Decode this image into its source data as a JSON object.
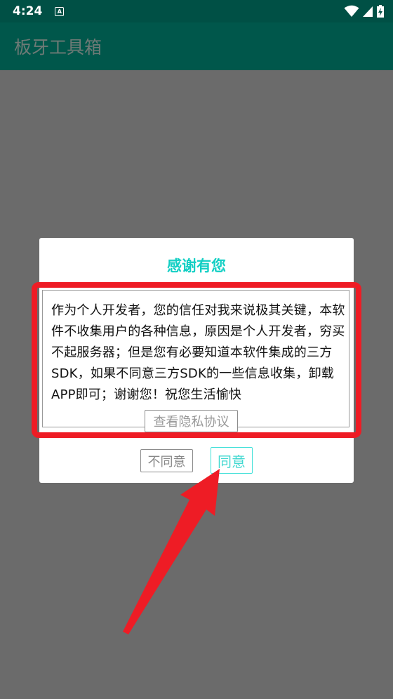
{
  "status_bar": {
    "time": "4:24",
    "notification_icon_letter": "A",
    "icons": [
      "wifi-icon",
      "signal-icon",
      "battery-charging-icon"
    ]
  },
  "app_bar": {
    "title": "板牙工具箱"
  },
  "dialog": {
    "title": "感谢有您",
    "body": "作为个人开发者，您的信任对我来说极其关键，本软件不收集用户的各种信息，原因是个人开发者，穷买不起服务器；但是您有必要知道本软件集成的三方SDK，如果不同意三方SDK的一些信息收集，卸载APP即可；谢谢您！祝您生活愉快",
    "privacy_button_label": "查看隐私协议",
    "disagree_button_label": "不同意",
    "agree_button_label": "同意"
  },
  "colors": {
    "status_bar": "#005045",
    "app_bar": "#00574b",
    "accent": "#12cfc4",
    "annotation": "#ee1c25",
    "scrim": "#6b6b6b"
  }
}
